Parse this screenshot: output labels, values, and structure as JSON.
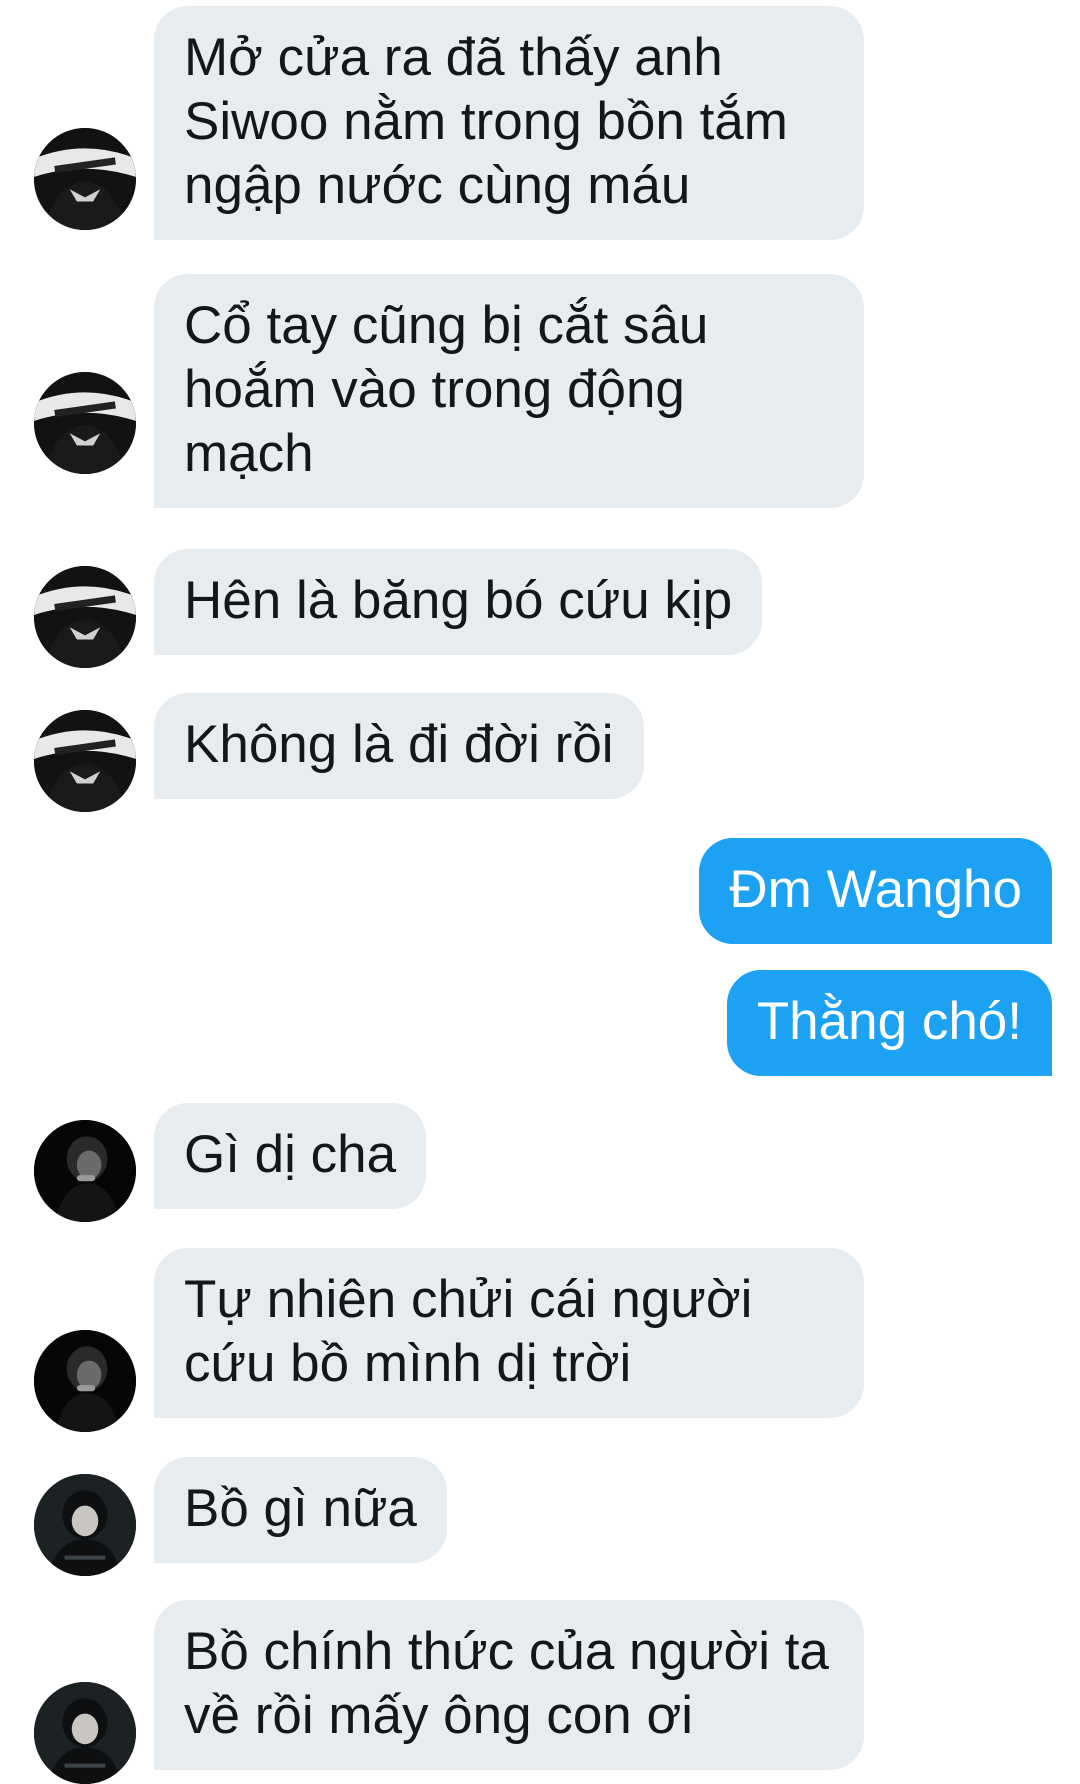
{
  "colors": {
    "incoming_bubble": "#e6ecf0",
    "outgoing_bubble": "#1da1f2",
    "incoming_text": "#14171a",
    "outgoing_text": "#ffffff"
  },
  "messages": [
    {
      "direction": "incoming",
      "text": "Mở cửa ra đã thấy anh\nSiwoo nằm trong bồn tắm\nngập nước cùng máu",
      "avatar": "champion-jersey-avatar"
    },
    {
      "direction": "incoming",
      "text": "Cổ tay cũng bị cắt sâu\nhoắm vào trong động\nmạch",
      "avatar": "champion-jersey-avatar"
    },
    {
      "direction": "incoming",
      "text": "Hên là băng bó cứu kịp",
      "avatar": "champion-jersey-avatar"
    },
    {
      "direction": "incoming",
      "text": "Không là đi đời rồi",
      "avatar": "champion-jersey-avatar"
    },
    {
      "direction": "outgoing",
      "text": "Đm Wangho",
      "avatar": ""
    },
    {
      "direction": "outgoing",
      "text": "Thằng chó!",
      "avatar": ""
    },
    {
      "direction": "incoming",
      "text": "Gì dị cha",
      "avatar": "dark-portrait-avatar"
    },
    {
      "direction": "incoming",
      "text": "Tự nhiên chửi cái người\ncứu bồ mình dị trời",
      "avatar": "dark-portrait-avatar"
    },
    {
      "direction": "incoming",
      "text": "Bồ gì nữa",
      "avatar": "hooded-portrait-avatar"
    },
    {
      "direction": "incoming",
      "text": "Bồ chính thức của người ta\nvề rồi mấy ông con ơi",
      "avatar": "hooded-portrait-avatar"
    }
  ]
}
